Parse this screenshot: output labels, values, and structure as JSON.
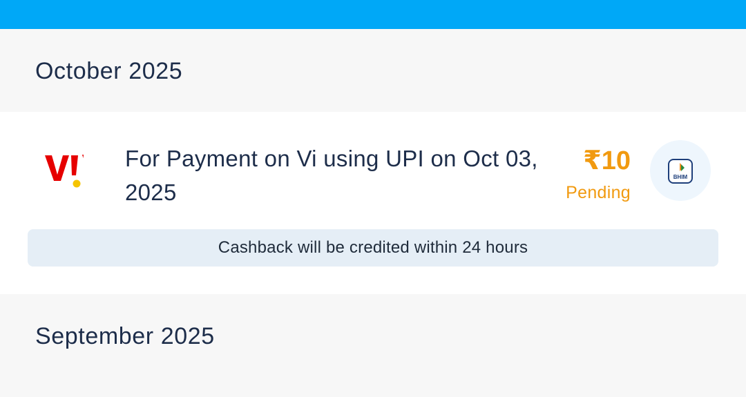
{
  "colors": {
    "top_bar": "#00a8f7",
    "section_bg": "#f7f7f7",
    "heading_text": "#1d2d4a",
    "pending_accent": "#f19a10",
    "note_bg": "#e5eef6",
    "vi_red": "#e60000",
    "vi_yellow": "#f5c400"
  },
  "sections": [
    {
      "month": "October 2025",
      "transactions": [
        {
          "merchant_logo": "vi-logo-icon",
          "description": "For Payment on Vi using UPI on Oct 03, 2025",
          "amount": "₹10",
          "status": "Pending",
          "payment_app_icon": "bhim-upi-icon",
          "note": "Cashback will be credited within 24 hours"
        }
      ]
    },
    {
      "month": "September 2025",
      "transactions": []
    }
  ]
}
